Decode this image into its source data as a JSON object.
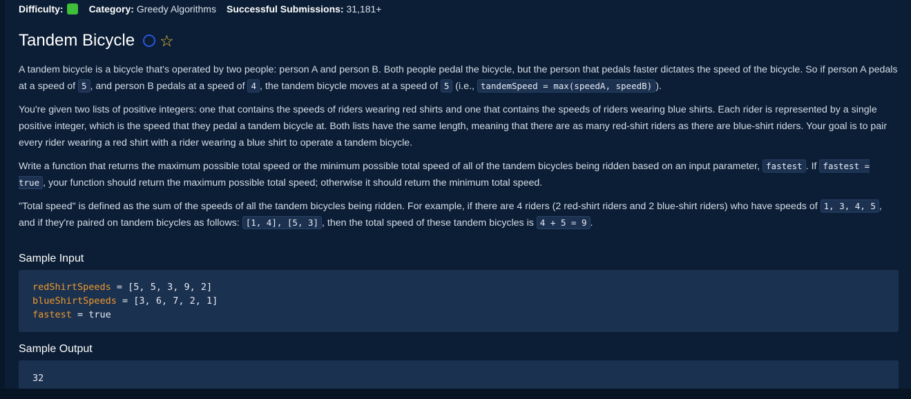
{
  "meta": {
    "difficulty_label": "Difficulty:",
    "category_label": "Category:",
    "category_value": "Greedy Algorithms",
    "submissions_label": "Successful Submissions:",
    "submissions_value": "31,181+",
    "difficulty_color": "#3fbf3a"
  },
  "title": "Tandem Bicycle",
  "icons": {
    "status": "circle-outline-icon",
    "favorite": "star-outline-icon"
  },
  "p1": {
    "t1": "A tandem bicycle is a bicycle that's operated by two people: person A and person B. Both people pedal the bicycle, but the person that pedals faster dictates the speed of the bicycle. So if person A pedals at a speed of ",
    "c1": "5",
    "t2": ", and person B pedals at a speed of ",
    "c2": "4",
    "t3": ", the tandem bicycle moves at a speed of ",
    "c3": "5",
    "t4": " (i.e., ",
    "c4": "tandemSpeed = max(speedA, speedB)",
    "t5": ")."
  },
  "p2": "You're given two lists of positive integers: one that contains the speeds of riders wearing red shirts and one that contains the speeds of riders wearing blue shirts. Each rider is represented by a single positive integer, which is the speed that they pedal a tandem bicycle at. Both lists have the same length, meaning that there are as many red-shirt riders as there are blue-shirt riders. Your goal is to pair every rider wearing a red shirt with a rider wearing a blue shirt to operate a tandem bicycle.",
  "p3": {
    "t1": "Write a function that returns the maximum possible total speed or the minimum possible total speed of all of the tandem bicycles being ridden based on an input parameter, ",
    "c1": "fastest",
    "t2": ". If ",
    "c2": "fastest = true",
    "t3": ", your function should return the maximum possible total speed; otherwise it should return the minimum total speed."
  },
  "p4": {
    "t1": "\"Total speed\" is defined as the sum of the speeds of all the tandem bicycles being ridden. For example, if there are 4 riders (2 red-shirt riders and 2 blue-shirt riders) who have speeds of ",
    "c1": "1, 3, 4, 5",
    "t2": ", and if they're paired on tandem bicycles as follows: ",
    "c2": "[1, 4], [5, 3]",
    "t3": ", then the total speed of these tandem bicycles is ",
    "c3": "4 + 5 = 9",
    "t4": "."
  },
  "sample_input": {
    "heading": "Sample Input",
    "lines": [
      {
        "name": "redShirtSpeeds",
        "rest": " = [5, 5, 3, 9, 2]"
      },
      {
        "name": "blueShirtSpeeds",
        "rest": " = [3, 6, 7, 2, 1]"
      },
      {
        "name": "fastest",
        "rest": " = true"
      }
    ]
  },
  "sample_output": {
    "heading": "Sample Output",
    "value": "32"
  }
}
